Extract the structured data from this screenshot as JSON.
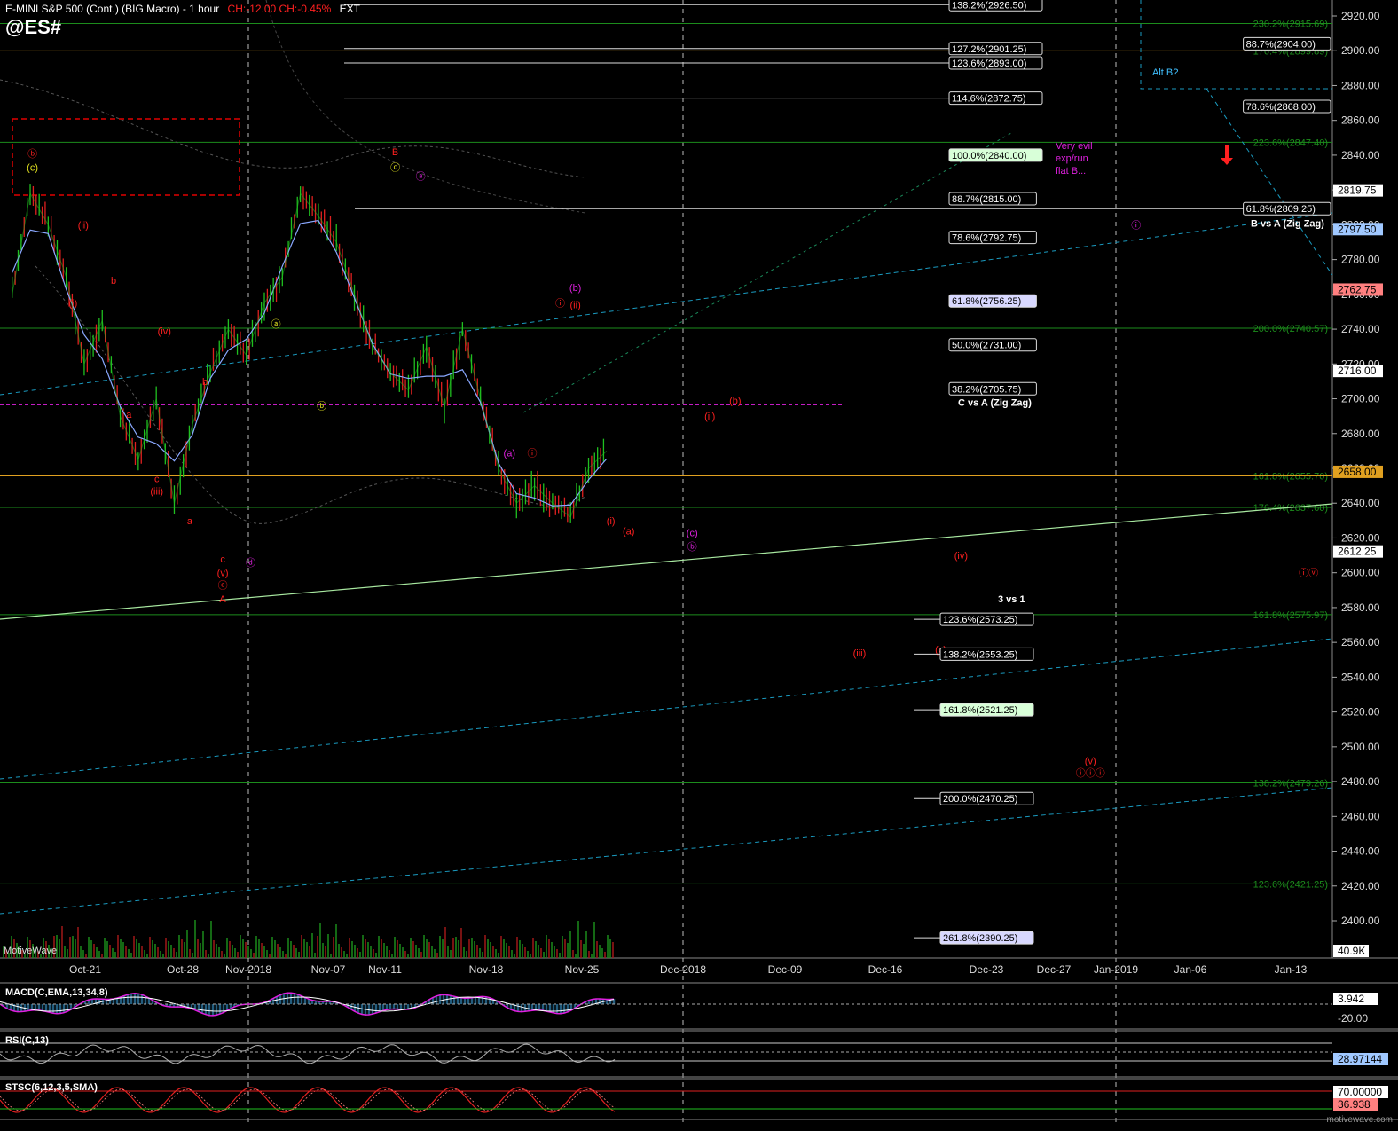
{
  "header": {
    "instrument": "E-MINI S&P 500 (Cont.) (BIG Macro) - 1 hour",
    "change": "CH:-12.00  CH:-0.45%",
    "session": "EXT",
    "ticker": "@ES#"
  },
  "colors": {
    "up_bar": "#20c020",
    "down_bar": "#e02020",
    "fib_line": "#1c8c1c",
    "gold_line": "#e0a020",
    "magenta": "#e020e0",
    "cyan_trend": "#1a9abf",
    "ma_line": "#8aa8ff",
    "box": "#e00000"
  },
  "price_axis": {
    "ticks": [
      "2920.00",
      "2900.00",
      "2880.00",
      "2860.00",
      "2840.00",
      "2820.00",
      "2800.00",
      "2780.00",
      "2760.00",
      "2740.00",
      "2720.00",
      "2700.00",
      "2680.00",
      "2660.00",
      "2640.00",
      "2620.00",
      "2600.00",
      "2580.00",
      "2560.00",
      "2540.00",
      "2520.00",
      "2500.00",
      "2480.00",
      "2460.00",
      "2440.00",
      "2420.00",
      "2400.00"
    ],
    "tick_values": [
      2920,
      2900,
      2880,
      2860,
      2840,
      2820,
      2800,
      2780,
      2760,
      2740,
      2720,
      2700,
      2680,
      2660,
      2640,
      2620,
      2600,
      2580,
      2560,
      2540,
      2520,
      2500,
      2480,
      2460,
      2440,
      2420,
      2400
    ],
    "markers": [
      {
        "label": "2819.75",
        "value": 2819.75,
        "color": "#ffffff"
      },
      {
        "label": "2797.50",
        "value": 2797.5,
        "color": "#a0c8ff"
      },
      {
        "label": "2762.75",
        "value": 2762.75,
        "color": "#ff8080"
      },
      {
        "label": "2716.00",
        "value": 2716,
        "color": "#ffffff"
      },
      {
        "label": "2658.00",
        "value": 2658,
        "color": "#e0a020"
      },
      {
        "label": "2612.25",
        "value": 2612.25,
        "color": "#ffffff"
      }
    ],
    "volume_marker": "40.9K"
  },
  "time_axis": {
    "labels": [
      "Oct-21",
      "Oct-28",
      "Nov-2018",
      "Nov-07",
      "Nov-11",
      "Nov-18",
      "Nov-25",
      "Dec-2018",
      "Dec-09",
      "Dec-16",
      "Dec-23",
      "Dec-27",
      "Jan-2019",
      "Jan-06",
      "Jan-13"
    ]
  },
  "chart_data": {
    "type": "line",
    "title": "E-MINI S&P 500 (Cont.) (BIG Macro) - 1 hour",
    "xlabel": "",
    "ylabel": "",
    "x": [
      "Oct-18",
      "Oct-19",
      "Oct-21",
      "Oct-22",
      "Oct-23",
      "Oct-24",
      "Oct-25",
      "Oct-26",
      "Oct-28",
      "Oct-29",
      "Oct-30",
      "Oct-31",
      "Nov-01",
      "Nov-02",
      "Nov-05",
      "Nov-06",
      "Nov-07",
      "Nov-08",
      "Nov-09",
      "Nov-11",
      "Nov-12",
      "Nov-13",
      "Nov-14",
      "Nov-15",
      "Nov-16",
      "Nov-18",
      "Nov-19",
      "Nov-20",
      "Nov-21",
      "Nov-22",
      "Nov-23",
      "Nov-25",
      "Nov-26",
      "Nov-27"
    ],
    "series": [
      {
        "values": [
          2760,
          2818,
          2800,
          2770,
          2720,
          2745,
          2690,
          2665,
          2700,
          2640,
          2685,
          2715,
          2740,
          2725,
          2755,
          2770,
          2818,
          2805,
          2790,
          2760,
          2730,
          2715,
          2705,
          2730,
          2695,
          2740,
          2700,
          2660,
          2640,
          2650,
          2640,
          2632,
          2660,
          2670
        ]
      }
    ],
    "ylim": [
      2390,
      2925
    ],
    "fib_levels_right": [
      {
        "label": "230.2%(2915.69)",
        "value": 2915.69
      },
      {
        "label": "176.4%(2899.89)",
        "value": 2899.89
      },
      {
        "label": "223.6%(2847.40)",
        "value": 2847.4
      },
      {
        "label": "200.0%(2740.57)",
        "value": 2740.57
      },
      {
        "label": "161.8%(2655.70)",
        "value": 2655.7
      },
      {
        "label": "176.4%(2637.60)",
        "value": 2637.6
      },
      {
        "label": "161.8%(2575.97)",
        "value": 2575.97
      },
      {
        "label": "138.2%(2479.26)",
        "value": 2479.26
      },
      {
        "label": "123.6%(2421.25)",
        "value": 2421.25
      }
    ],
    "boxed_levels": [
      {
        "label": "138.2%(2926.50)",
        "value": 2926.5,
        "group": "b"
      },
      {
        "label": "127.2%(2901.25)",
        "value": 2901.25,
        "group": "b"
      },
      {
        "label": "123.6%(2893.00)",
        "value": 2893.0,
        "group": "b"
      },
      {
        "label": "114.6%(2872.75)",
        "value": 2872.75,
        "group": "b"
      },
      {
        "label": "100.0%(2840.00)",
        "value": 2840.0,
        "group": "b",
        "bg": "#d8ffd8"
      },
      {
        "label": "88.7%(2815.00)",
        "value": 2815.0,
        "group": "b"
      },
      {
        "label": "78.6%(2792.75)",
        "value": 2792.75,
        "group": "b"
      },
      {
        "label": "61.8%(2756.25)",
        "value": 2756.25,
        "group": "b",
        "bg": "#d8d8ff"
      },
      {
        "label": "50.0%(2731.00)",
        "value": 2731.0,
        "group": "b"
      },
      {
        "label": "38.2%(2705.75)",
        "value": 2705.75,
        "group": "b"
      },
      {
        "label": "88.7%(2904.00)",
        "value": 2904.0,
        "group": "r"
      },
      {
        "label": "78.6%(2868.00)",
        "value": 2868.0,
        "group": "r"
      },
      {
        "label": "61.8%(2809.25)",
        "value": 2809.25,
        "group": "r"
      },
      {
        "label": "123.6%(2573.25)",
        "value": 2573.25,
        "group": "c"
      },
      {
        "label": "138.2%(2553.25)",
        "value": 2553.25,
        "group": "c"
      },
      {
        "label": "161.8%(2521.25)",
        "value": 2521.25,
        "group": "c",
        "bg": "#d8ffd8"
      },
      {
        "label": "200.0%(2470.25)",
        "value": 2470.25,
        "group": "c"
      },
      {
        "label": "261.8%(2390.25)",
        "value": 2390.25,
        "group": "c",
        "bg": "#d8d8ff"
      }
    ],
    "group_titles": [
      {
        "text": "C vs A (Zig Zag)",
        "value": 2696
      },
      {
        "text": "B vs A (Zig Zag)",
        "value": 2799
      },
      {
        "text": "3 vs 1",
        "value": 2583
      }
    ],
    "wave_labels": [
      {
        "text": "ⓑ",
        "color": "#ff2020",
        "t": 1,
        "v": 2839
      },
      {
        "text": "(c)",
        "color": "#e0e020",
        "t": 1,
        "v": 2831
      },
      {
        "text": "(ii)",
        "color": "#ff2020",
        "t": 3,
        "v": 2798
      },
      {
        "text": "(i)",
        "color": "#ff2020",
        "t": 2.6,
        "v": 2753
      },
      {
        "text": "b",
        "color": "#ff2020",
        "t": 4.2,
        "v": 2766
      },
      {
        "text": "a",
        "color": "#ff2020",
        "t": 4.8,
        "v": 2689
      },
      {
        "text": "(iv)",
        "color": "#ff2020",
        "t": 6.2,
        "v": 2737
      },
      {
        "text": "c",
        "color": "#ff2020",
        "t": 5.9,
        "v": 2652
      },
      {
        "text": "(iii)",
        "color": "#ff2020",
        "t": 5.9,
        "v": 2645
      },
      {
        "text": "b",
        "color": "#ff2020",
        "t": 7.8,
        "v": 2708
      },
      {
        "text": "a",
        "color": "#ff2020",
        "t": 7.2,
        "v": 2628
      },
      {
        "text": "c",
        "color": "#ff2020",
        "t": 8.5,
        "v": 2606
      },
      {
        "text": "(v)",
        "color": "#ff2020",
        "t": 8.5,
        "v": 2598
      },
      {
        "text": "ⓒ",
        "color": "#ff2020",
        "t": 8.5,
        "v": 2591
      },
      {
        "text": "A",
        "color": "#ff2020",
        "t": 8.5,
        "v": 2583
      },
      {
        "text": "ⓓ",
        "color": "#e020e0",
        "t": 9.6,
        "v": 2604
      },
      {
        "text": "ⓐ",
        "color": "#e0e020",
        "t": 10.6,
        "v": 2741
      },
      {
        "text": "ⓑ",
        "color": "#e0e020",
        "t": 12.4,
        "v": 2694
      },
      {
        "text": "B",
        "color": "#ff2020",
        "t": 15.3,
        "v": 2840
      },
      {
        "text": "ⓒ",
        "color": "#e0e020",
        "t": 15.3,
        "v": 2831
      },
      {
        "text": "ⓐ",
        "color": "#e020e0",
        "t": 16.3,
        "v": 2826
      },
      {
        "text": "(a)",
        "color": "#e020e0",
        "t": 19.8,
        "v": 2667
      },
      {
        "text": "ⓘ",
        "color": "#ff2020",
        "t": 20.7,
        "v": 2667
      },
      {
        "text": "(b)",
        "color": "#e020e0",
        "t": 22.4,
        "v": 2762
      },
      {
        "text": "ⓘ",
        "color": "#ff2020",
        "t": 21.8,
        "v": 2753
      },
      {
        "text": "(ii)",
        "color": "#ff2020",
        "t": 22.4,
        "v": 2752
      },
      {
        "text": "(i)",
        "color": "#ff2020",
        "t": 23.8,
        "v": 2628
      },
      {
        "text": "(a)",
        "color": "#ff2020",
        "t": 24.5,
        "v": 2622
      },
      {
        "text": "(c)",
        "color": "#e020e0",
        "t": 27.0,
        "v": 2621
      },
      {
        "text": "ⓑ",
        "color": "#e020e0",
        "t": 27.0,
        "v": 2613
      },
      {
        "text": "(ii)",
        "color": "#ff2020",
        "t": 27.7,
        "v": 2688
      },
      {
        "text": "(b)",
        "color": "#ff2020",
        "t": 28.7,
        "v": 2697
      },
      {
        "text": "(iv)",
        "color": "#ff2020",
        "t": 37.6,
        "v": 2608
      },
      {
        "text": "ⓘ",
        "color": "#e020e0",
        "t": 44.5,
        "v": 2798
      },
      {
        "text": "(iii)",
        "color": "#ff2020",
        "t": 33.6,
        "v": 2552
      },
      {
        "text": "(c)",
        "color": "#ff2020",
        "t": 36.8,
        "v": 2554
      },
      {
        "text": "(v)",
        "color": "#ff2020",
        "t": 42.7,
        "v": 2490
      },
      {
        "text": "ⓘⓘⓘ",
        "color": "#ff2020",
        "t": 42.7,
        "v": 2483
      },
      {
        "text": "ⓘⓥ",
        "color": "#ff2020",
        "t": 51.3,
        "v": 2598
      }
    ],
    "annotations": [
      {
        "text": "Very evil",
        "color": "#e020e0"
      },
      {
        "text": "exp/run",
        "color": "#e020e0"
      },
      {
        "text": "flat B...",
        "color": "#e020e0"
      }
    ],
    "alt_label": "Alt B?"
  },
  "indicators": {
    "macd": {
      "label": "MACD(C,EMA,13,34,8)",
      "value": "3.942",
      "low": "-20.00"
    },
    "rsi": {
      "label": "RSI(C,13)",
      "value": "28.97144"
    },
    "stsc": {
      "label": "STSC(6,12,3,5,SMA)",
      "upper": "70.00000",
      "value": "36.938"
    }
  },
  "footer": {
    "brand": "MotiveWave",
    "watermark": "motivewave.com"
  }
}
